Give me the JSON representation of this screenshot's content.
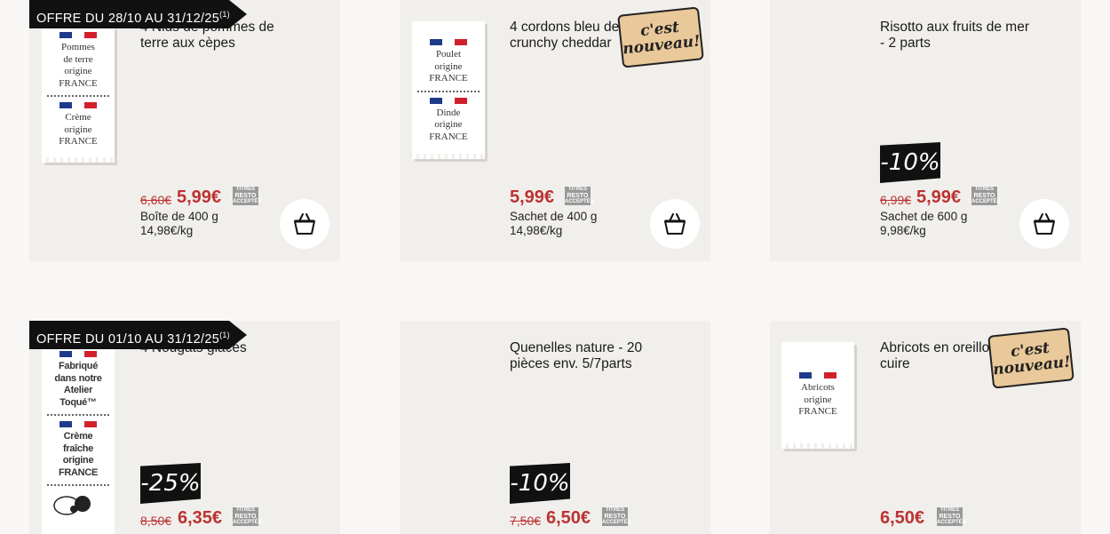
{
  "row1": {
    "offer_banner": {
      "text": "OFFRE DU 28/10 AU 31/12/25",
      "note": "(1)"
    },
    "cards": [
      {
        "title": "4 Nids de pommes de terre aux cèpes",
        "labels": [
          {
            "lines": [
              "Pommes",
              "de terre",
              "origine",
              "FRANCE"
            ]
          },
          {
            "lines": [
              "Crème",
              "origine",
              "FRANCE"
            ]
          }
        ],
        "old_price": "6,60€",
        "price": "5,99€",
        "pack": "Boîte de 400 g",
        "unit_price": "14,98€/kg",
        "resto": "TITRES RESTO ACCEPTÉS"
      },
      {
        "title": "4 cordons bleu de dinde crunchy cheddar",
        "labels": [
          {
            "lines": [
              "Poulet",
              "origine",
              "FRANCE"
            ]
          },
          {
            "lines": [
              "Dinde",
              "origine",
              "FRANCE"
            ]
          }
        ],
        "badge": "c'est nouveau!",
        "price": "5,99€",
        "pack": "Sachet de 400 g",
        "unit_price": "14,98€/kg",
        "resto": "TITRES RESTO ACCEPTÉS"
      },
      {
        "title": "Risotto aux fruits de mer - 2 parts",
        "discount": "-10%",
        "old_price": "6,99€",
        "price": "5,99€",
        "pack": "Sachet de 600 g",
        "unit_price": "9,98€/kg",
        "resto": "TITRES RESTO ACCEPTÉS"
      }
    ]
  },
  "row2": {
    "offer_banner": {
      "text": "OFFRE DU 01/10 AU 31/12/25",
      "note": "(1)"
    },
    "cards": [
      {
        "title": "4 Nougats glacés",
        "labels": [
          {
            "lines": [
              "Fabriqué",
              "dans notre",
              "Atelier Toqué™"
            ]
          },
          {
            "lines": [
              "Crème",
              "fraîche",
              "origine",
              "FRANCE"
            ]
          }
        ],
        "discount": "-25%",
        "old_price": "8,50€",
        "price": "6,35€",
        "resto": "TITRES RESTO ACCEPTÉS"
      },
      {
        "title": "Quenelles nature - 20 pièces env. 5/7parts",
        "discount": "-10%",
        "old_price": "7,50€",
        "price": "6,50€",
        "resto": "TITRES RESTO ACCEPTÉS"
      },
      {
        "title": "Abricots en oreillons à cuire",
        "labels": [
          {
            "lines": [
              "Abricots",
              "origine",
              "FRANCE"
            ]
          }
        ],
        "badge": "c'est nouveau!",
        "price": "6,50€",
        "resto": "TITRES RESTO ACCEPTÉS"
      }
    ]
  },
  "icons": {
    "basket": "shopping-basket-icon",
    "flag": "french-flag-icon"
  },
  "colors": {
    "price": "#b33333",
    "banner": "#111111",
    "card": "#f1efec",
    "nouveau_bg": "#e9c89a"
  }
}
